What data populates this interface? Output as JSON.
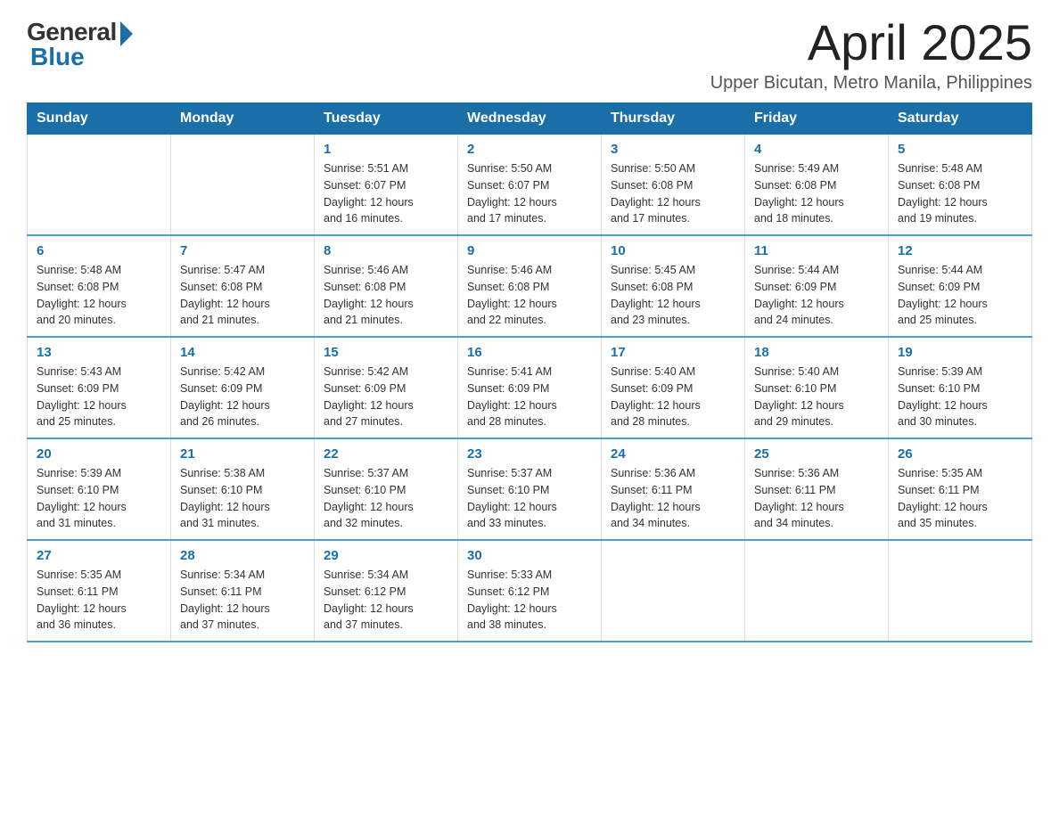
{
  "logo": {
    "general": "General",
    "blue": "Blue"
  },
  "header": {
    "month": "April 2025",
    "location": "Upper Bicutan, Metro Manila, Philippines"
  },
  "days_of_week": [
    "Sunday",
    "Monday",
    "Tuesday",
    "Wednesday",
    "Thursday",
    "Friday",
    "Saturday"
  ],
  "weeks": [
    [
      {
        "day": "",
        "info": ""
      },
      {
        "day": "",
        "info": ""
      },
      {
        "day": "1",
        "info": "Sunrise: 5:51 AM\nSunset: 6:07 PM\nDaylight: 12 hours\nand 16 minutes."
      },
      {
        "day": "2",
        "info": "Sunrise: 5:50 AM\nSunset: 6:07 PM\nDaylight: 12 hours\nand 17 minutes."
      },
      {
        "day": "3",
        "info": "Sunrise: 5:50 AM\nSunset: 6:08 PM\nDaylight: 12 hours\nand 17 minutes."
      },
      {
        "day": "4",
        "info": "Sunrise: 5:49 AM\nSunset: 6:08 PM\nDaylight: 12 hours\nand 18 minutes."
      },
      {
        "day": "5",
        "info": "Sunrise: 5:48 AM\nSunset: 6:08 PM\nDaylight: 12 hours\nand 19 minutes."
      }
    ],
    [
      {
        "day": "6",
        "info": "Sunrise: 5:48 AM\nSunset: 6:08 PM\nDaylight: 12 hours\nand 20 minutes."
      },
      {
        "day": "7",
        "info": "Sunrise: 5:47 AM\nSunset: 6:08 PM\nDaylight: 12 hours\nand 21 minutes."
      },
      {
        "day": "8",
        "info": "Sunrise: 5:46 AM\nSunset: 6:08 PM\nDaylight: 12 hours\nand 21 minutes."
      },
      {
        "day": "9",
        "info": "Sunrise: 5:46 AM\nSunset: 6:08 PM\nDaylight: 12 hours\nand 22 minutes."
      },
      {
        "day": "10",
        "info": "Sunrise: 5:45 AM\nSunset: 6:08 PM\nDaylight: 12 hours\nand 23 minutes."
      },
      {
        "day": "11",
        "info": "Sunrise: 5:44 AM\nSunset: 6:09 PM\nDaylight: 12 hours\nand 24 minutes."
      },
      {
        "day": "12",
        "info": "Sunrise: 5:44 AM\nSunset: 6:09 PM\nDaylight: 12 hours\nand 25 minutes."
      }
    ],
    [
      {
        "day": "13",
        "info": "Sunrise: 5:43 AM\nSunset: 6:09 PM\nDaylight: 12 hours\nand 25 minutes."
      },
      {
        "day": "14",
        "info": "Sunrise: 5:42 AM\nSunset: 6:09 PM\nDaylight: 12 hours\nand 26 minutes."
      },
      {
        "day": "15",
        "info": "Sunrise: 5:42 AM\nSunset: 6:09 PM\nDaylight: 12 hours\nand 27 minutes."
      },
      {
        "day": "16",
        "info": "Sunrise: 5:41 AM\nSunset: 6:09 PM\nDaylight: 12 hours\nand 28 minutes."
      },
      {
        "day": "17",
        "info": "Sunrise: 5:40 AM\nSunset: 6:09 PM\nDaylight: 12 hours\nand 28 minutes."
      },
      {
        "day": "18",
        "info": "Sunrise: 5:40 AM\nSunset: 6:10 PM\nDaylight: 12 hours\nand 29 minutes."
      },
      {
        "day": "19",
        "info": "Sunrise: 5:39 AM\nSunset: 6:10 PM\nDaylight: 12 hours\nand 30 minutes."
      }
    ],
    [
      {
        "day": "20",
        "info": "Sunrise: 5:39 AM\nSunset: 6:10 PM\nDaylight: 12 hours\nand 31 minutes."
      },
      {
        "day": "21",
        "info": "Sunrise: 5:38 AM\nSunset: 6:10 PM\nDaylight: 12 hours\nand 31 minutes."
      },
      {
        "day": "22",
        "info": "Sunrise: 5:37 AM\nSunset: 6:10 PM\nDaylight: 12 hours\nand 32 minutes."
      },
      {
        "day": "23",
        "info": "Sunrise: 5:37 AM\nSunset: 6:10 PM\nDaylight: 12 hours\nand 33 minutes."
      },
      {
        "day": "24",
        "info": "Sunrise: 5:36 AM\nSunset: 6:11 PM\nDaylight: 12 hours\nand 34 minutes."
      },
      {
        "day": "25",
        "info": "Sunrise: 5:36 AM\nSunset: 6:11 PM\nDaylight: 12 hours\nand 34 minutes."
      },
      {
        "day": "26",
        "info": "Sunrise: 5:35 AM\nSunset: 6:11 PM\nDaylight: 12 hours\nand 35 minutes."
      }
    ],
    [
      {
        "day": "27",
        "info": "Sunrise: 5:35 AM\nSunset: 6:11 PM\nDaylight: 12 hours\nand 36 minutes."
      },
      {
        "day": "28",
        "info": "Sunrise: 5:34 AM\nSunset: 6:11 PM\nDaylight: 12 hours\nand 37 minutes."
      },
      {
        "day": "29",
        "info": "Sunrise: 5:34 AM\nSunset: 6:12 PM\nDaylight: 12 hours\nand 37 minutes."
      },
      {
        "day": "30",
        "info": "Sunrise: 5:33 AM\nSunset: 6:12 PM\nDaylight: 12 hours\nand 38 minutes."
      },
      {
        "day": "",
        "info": ""
      },
      {
        "day": "",
        "info": ""
      },
      {
        "day": "",
        "info": ""
      }
    ]
  ]
}
